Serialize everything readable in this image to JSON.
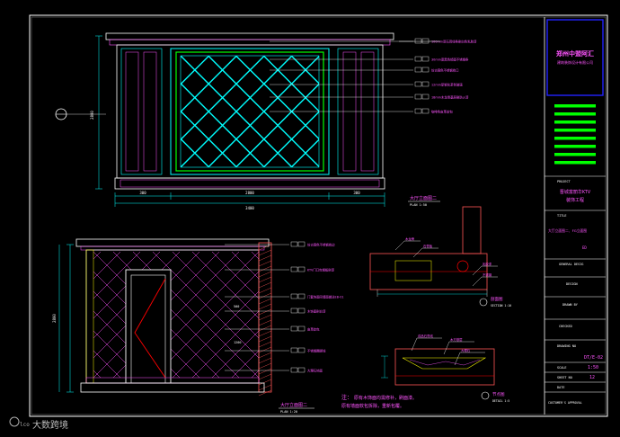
{
  "colors": {
    "background": "#000000",
    "frame": "#ffffff",
    "label": "#ff00ff",
    "dimension": "#00ffff",
    "accent": "#00ff00",
    "panel_title": "#0000ff",
    "wall": "#ff5555",
    "hatch": "#ffff00",
    "detail": "#ff0000"
  },
  "title_block": {
    "company_name": "郑州中盟阿汇",
    "company_sub": "建筑装饰设计有限公司",
    "project_label": "PROJECT",
    "project_name_1": "晋城富丽华KTV",
    "project_name_2": "装饰工程",
    "title_label": "TITLE",
    "title_value": "大厅立面图二、FG立面图",
    "title_code": "ED",
    "general_label": "GENERAL DESIG",
    "design_label": "DESIGN",
    "drawn_label": "DRAWN BY",
    "checked_label": "CHECKED",
    "drawing_no_label": "DRAWING NO",
    "drawing_no_value": "DT/E-02",
    "scale_label": "SCALE",
    "scale_value": "1:50",
    "sheet_label": "SHEET NO",
    "sheet_value": "12",
    "date_label": "DATE",
    "approval_label": "CUSTOMER'S APPROVAL"
  },
  "views": {
    "top_title": "大厅立面图二",
    "top_scale": "PLAN 1:50",
    "bottom_title": "大厅立面图二",
    "bottom_scale": "PLAN 1:20",
    "detail_a_title": "剖面图",
    "detail_a_scale": "SECTION 1:10",
    "detail_b_title": "节点图",
    "detail_b_scale": "DETAIL 1:5"
  },
  "dimensions": {
    "top_total": "3400",
    "top_seg_1": "300",
    "top_seg_2": "2800",
    "top_seg_3": "300",
    "top_height": "2800",
    "bottom_height": "2800",
    "bottom_seg_1": "500",
    "bottom_seg_2": "1200"
  },
  "annotations": {
    "top": [
      "100mm厚石膏线条刷白色乳胶漆",
      "30mm宽黑色镜面不锈钢条",
      "仿古铜色不锈钢收口",
      "12mm厚钢化茶色玻璃",
      "18mm木龙骨基层刷防火漆",
      "咖啡色皮革软包"
    ],
    "bottom": [
      "仿古铜色不锈钢收边",
      "KTV门口包钢板刷漆",
      "门套饰面同墙面做法EB-01",
      "木饰面刷白漆",
      "皮革软包",
      "不锈钢踢脚线",
      "大理石地面"
    ],
    "detail_a": [
      "木龙骨",
      "石膏板",
      "乳胶漆",
      "不锈钢"
    ],
    "detail_b": [
      "成品石膏线",
      "木方基层",
      "大理石"
    ]
  },
  "note_label": "注：",
  "note_line_1": "原有木饰面均需修补，刷面漆。",
  "note_line_2": "原有墙面软包拆除，重新包覆。",
  "watermark": "大数跨境"
}
